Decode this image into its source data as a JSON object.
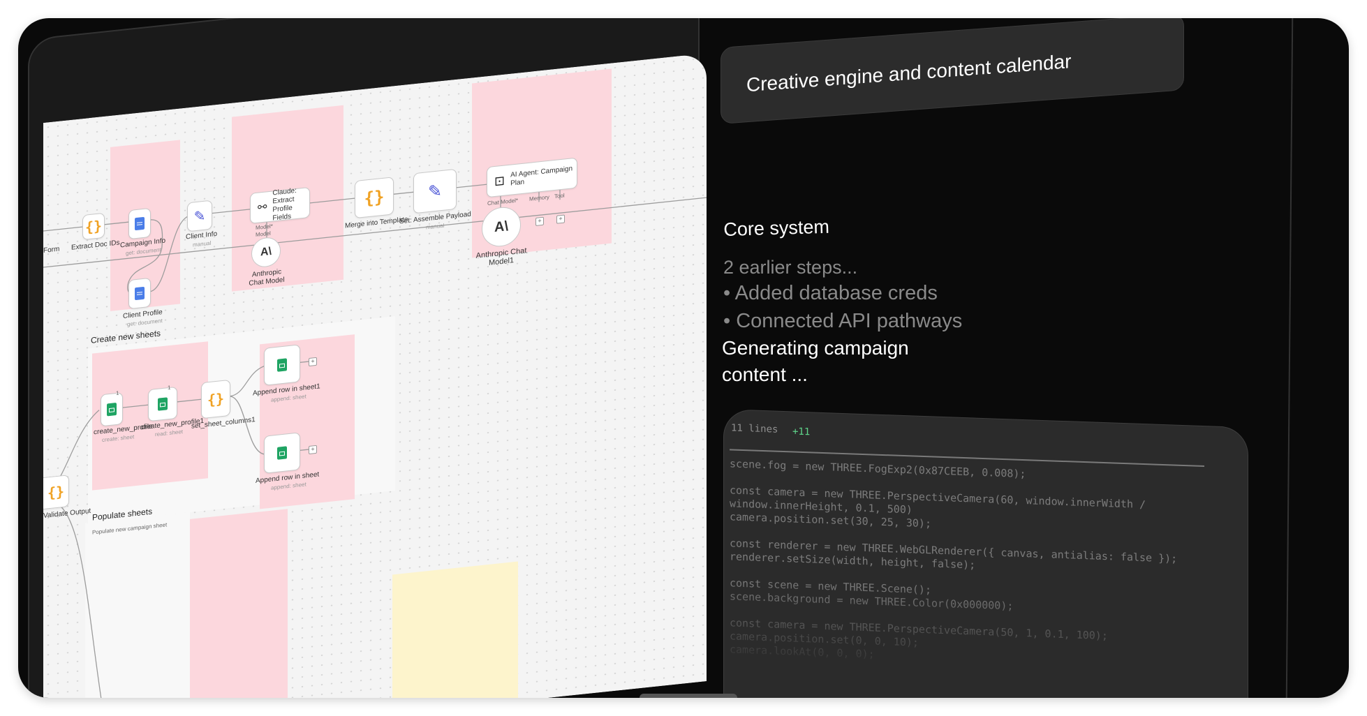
{
  "canvas": {
    "nodes": {
      "form": "Form",
      "extract_doc_ids": "Extract Doc IDs",
      "campaign_info": "Campaign Info",
      "campaign_info_sub": "get: document",
      "client_profile": "Client Profile",
      "client_profile_sub": "get: document",
      "client_info": "Client Info",
      "client_info_sub": "manual",
      "claude_extract": "Claude: Extract Profile Fields",
      "model_tag": "Model*",
      "model_tag2": "Model",
      "anthropic_chat_model": "Anthropic Chat Model",
      "merge_template": "Merge into Template",
      "assemble_payload": "Set: Assemble Payload",
      "assemble_payload_sub": "manual",
      "ai_agent": "AI Agent: Campaign Plan",
      "chat_model_tag": "Chat Model*",
      "memory_tag": "Memory",
      "tool_tag": "Tool",
      "anthropic_chat_model1": "Anthropic Chat Model1",
      "create_new_profile": "create_new_profile",
      "create_new_profile_sub": "create: sheet",
      "create_new_profile1": "create_new_profile1",
      "create_new_profile1_sub": "read: sheet",
      "set_sheet_columns1": "set_sheet_columns1",
      "append_row_sheet1": "Append row in sheet1",
      "append_row_sheet1_sub": "append: sheet",
      "append_row_sheet": "Append row in sheet",
      "append_row_sheet_sub": "append: sheet",
      "validate_output": "Validate Output",
      "badge_1": "1",
      "badge_2": "1"
    },
    "sections": {
      "create_new_sheets": "Create new sheets",
      "populate_sheets": "Populate sheets",
      "populate_sheets_sub": "Populate new campaign sheet"
    },
    "icons": {
      "brace": "{}",
      "pen": "✎",
      "link": "⚯",
      "robot": "⊡",
      "anthropic": "A\\",
      "plus": "+"
    }
  },
  "panel": {
    "title": "Creative engine and content calendar",
    "core_title": "Core system",
    "steps_summary": "2 earlier steps...",
    "steps": [
      "• Added database creds",
      "• Connected API pathways"
    ],
    "generating": "Generating campaign content ..."
  },
  "code": {
    "line_count": "11 lines",
    "added": "+11",
    "lines": [
      "scene.fog = new THREE.FogExp2(0x87CEEB, 0.008);",
      "",
      "const camera = new THREE.PerspectiveCamera(60, window.innerWidth /",
      "window.innerHeight, 0.1, 500)",
      "camera.position.set(30, 25, 30);",
      "",
      "const renderer = new THREE.WebGLRenderer({ canvas, antialias: false });",
      "renderer.setSize(width, height, false);",
      "",
      "const scene = new THREE.Scene();",
      "scene.background = new THREE.Color(0x000000);",
      "",
      "const camera = new THREE.PerspectiveCamera(50, 1, 0.1, 100);",
      "camera.position.set(0, 0, 10);",
      "camera.lookAt(0, 0, 0);"
    ]
  }
}
